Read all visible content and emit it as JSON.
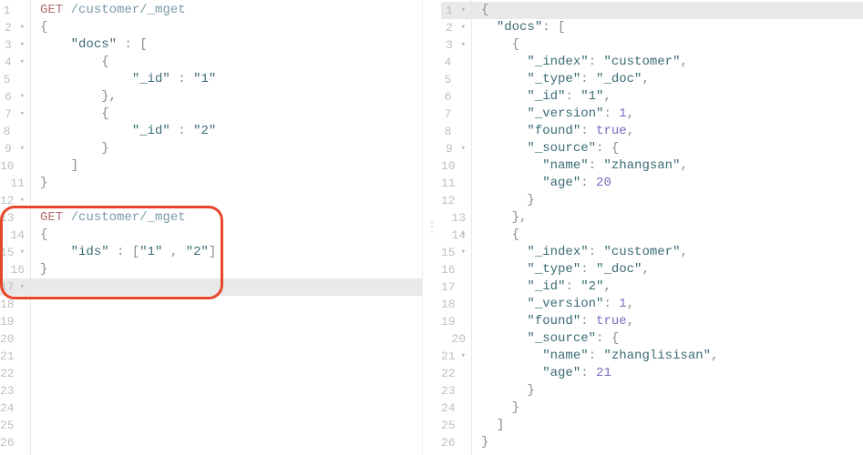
{
  "left": {
    "gutter": [
      {
        "n": "1",
        "fold": ""
      },
      {
        "n": "2",
        "fold": "▾"
      },
      {
        "n": "3",
        "fold": "▾"
      },
      {
        "n": "4",
        "fold": "▾"
      },
      {
        "n": "5",
        "fold": ""
      },
      {
        "n": "6",
        "fold": "▾"
      },
      {
        "n": "7",
        "fold": "▾"
      },
      {
        "n": "8",
        "fold": ""
      },
      {
        "n": "9",
        "fold": "▾"
      },
      {
        "n": "10",
        "fold": ""
      },
      {
        "n": "11",
        "fold": "▾"
      },
      {
        "n": "12",
        "fold": ""
      },
      {
        "n": "13",
        "fold": ""
      },
      {
        "n": "14",
        "fold": "▾"
      },
      {
        "n": "15",
        "fold": ""
      },
      {
        "n": "16",
        "fold": "▾"
      },
      {
        "n": "17",
        "fold": ""
      },
      {
        "n": "18",
        "fold": ""
      },
      {
        "n": "19",
        "fold": ""
      },
      {
        "n": "20",
        "fold": ""
      },
      {
        "n": "21",
        "fold": ""
      },
      {
        "n": "22",
        "fold": ""
      },
      {
        "n": "23",
        "fold": ""
      },
      {
        "n": "24",
        "fold": ""
      },
      {
        "n": "25",
        "fold": ""
      },
      {
        "n": "26",
        "fold": ""
      }
    ],
    "req1": {
      "method": "GET",
      "path": "/customer/_mget",
      "docs_key": "\"docs\"",
      "id1_key": "\"_id\"",
      "id1_val": "\"1\"",
      "id2_key": "\"_id\"",
      "id2_val": "\"2\""
    },
    "req2": {
      "method": "GET",
      "path": "/customer/_mget",
      "ids_key": "\"ids\"",
      "ids_arr_open": "[",
      "ids_v1": "\"1\"",
      "ids_sep": " , ",
      "ids_v2": "\"2\"",
      "ids_arr_close": "]"
    }
  },
  "right": {
    "gutter": [
      {
        "n": "1",
        "fold": "▾"
      },
      {
        "n": "2",
        "fold": "▾"
      },
      {
        "n": "3",
        "fold": "▾"
      },
      {
        "n": "4",
        "fold": ""
      },
      {
        "n": "5",
        "fold": ""
      },
      {
        "n": "6",
        "fold": ""
      },
      {
        "n": "7",
        "fold": ""
      },
      {
        "n": "8",
        "fold": ""
      },
      {
        "n": "9",
        "fold": "▾"
      },
      {
        "n": "10",
        "fold": ""
      },
      {
        "n": "11",
        "fold": ""
      },
      {
        "n": "12",
        "fold": ""
      },
      {
        "n": "13",
        "fold": "▾"
      },
      {
        "n": "14",
        "fold": "▾"
      },
      {
        "n": "15",
        "fold": ""
      },
      {
        "n": "16",
        "fold": ""
      },
      {
        "n": "17",
        "fold": ""
      },
      {
        "n": "18",
        "fold": ""
      },
      {
        "n": "19",
        "fold": ""
      },
      {
        "n": "20",
        "fold": "▾"
      },
      {
        "n": "21",
        "fold": ""
      },
      {
        "n": "22",
        "fold": ""
      },
      {
        "n": "23",
        "fold": ""
      },
      {
        "n": "24",
        "fold": ""
      },
      {
        "n": "25",
        "fold": ""
      },
      {
        "n": "26",
        "fold": ""
      }
    ],
    "resp": {
      "docs_key": "\"docs\"",
      "d0_index_k": "\"_index\"",
      "d0_index_v": "\"customer\"",
      "d0_type_k": "\"_type\"",
      "d0_type_v": "\"_doc\"",
      "d0_id_k": "\"_id\"",
      "d0_id_v": "\"1\"",
      "d0_ver_k": "\"_version\"",
      "d0_ver_v": "1",
      "d0_found_k": "\"found\"",
      "d0_found_v": "true",
      "d0_src_k": "\"_source\"",
      "d0_name_k": "\"name\"",
      "d0_name_v": "\"zhangsan\"",
      "d0_age_k": "\"age\"",
      "d0_age_v": "20",
      "d1_index_k": "\"_index\"",
      "d1_index_v": "\"customer\"",
      "d1_type_k": "\"_type\"",
      "d1_type_v": "\"_doc\"",
      "d1_id_k": "\"_id\"",
      "d1_id_v": "\"2\"",
      "d1_ver_k": "\"_version\"",
      "d1_ver_v": "1",
      "d1_found_k": "\"found\"",
      "d1_found_v": "true",
      "d1_src_k": "\"_source\"",
      "d1_name_k": "\"name\"",
      "d1_name_v": "\"zhanglisisan\"",
      "d1_age_k": "\"age\"",
      "d1_age_v": "21"
    }
  },
  "divider": "⋮"
}
